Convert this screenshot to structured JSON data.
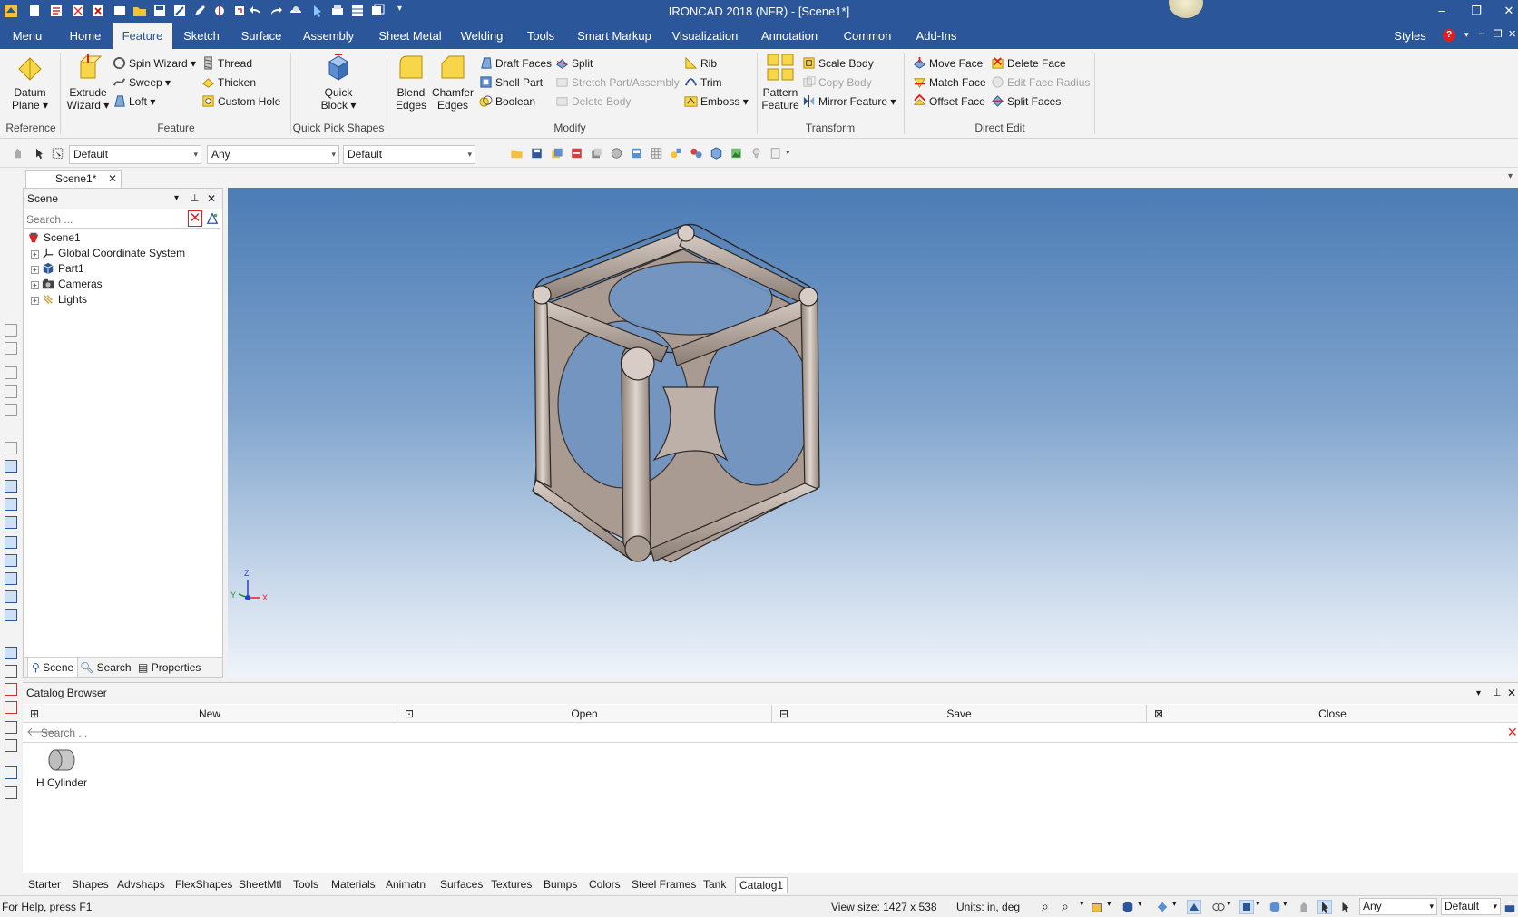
{
  "window": {
    "title": "IRONCAD 2018 (NFR) - [Scene1*]",
    "controls": {
      "minimize": "–",
      "restore": "❐",
      "close": "✕"
    }
  },
  "menu_tabs": [
    "Menu",
    "Home",
    "Feature",
    "Sketch",
    "Surface",
    "Assembly",
    "Sheet Metal",
    "Welding",
    "Tools",
    "Smart Markup",
    "Visualization",
    "Annotation",
    "Common",
    "Add-Ins"
  ],
  "menu_active": "Feature",
  "menu_right": {
    "styles": "Styles"
  },
  "ribbon": {
    "reference": {
      "datum_plane": "Datum",
      "datum_plane2": "Plane ▾",
      "group": "Reference"
    },
    "feature": {
      "extrude": "Extrude",
      "extrude2": "Wizard ▾",
      "spin_wizard": "Spin Wizard",
      "sweep": "Sweep",
      "loft": "Loft",
      "thread": "Thread",
      "thicken": "Thicken",
      "custom_hole": "Custom Hole",
      "group": "Feature"
    },
    "quick": {
      "quick_block": "Quick",
      "quick_block2": "Block ▾",
      "group": "Quick Pick Shapes"
    },
    "modify": {
      "blend": "Blend",
      "blend2": "Edges",
      "chamfer": "Chamfer",
      "chamfer2": "Edges",
      "draft_faces": "Draft Faces",
      "shell_part": "Shell Part",
      "boolean": "Boolean",
      "split": "Split",
      "stretch": "Stretch Part/Assembly",
      "delete_body": "Delete Body",
      "rib": "Rib",
      "trim": "Trim",
      "emboss": "Emboss",
      "group": "Modify"
    },
    "transform": {
      "pattern": "Pattern",
      "pattern2": "Feature",
      "scale_body": "Scale Body",
      "copy_body": "Copy Body",
      "mirror_feature": "Mirror Feature",
      "group": "Transform"
    },
    "direct_edit": {
      "move_face": "Move Face",
      "match_face": "Match Face",
      "offset_face": "Offset Face",
      "delete_face": "Delete Face",
      "edit_face_radius": "Edit Face Radius",
      "split_faces": "Split Faces",
      "group": "Direct Edit"
    }
  },
  "toolbar": {
    "combo1": "Default",
    "combo2": "Any",
    "combo3": "Default"
  },
  "doc_tab": {
    "label": "Scene1*"
  },
  "scene_panel": {
    "title": "Scene",
    "search_placeholder": "Search ...",
    "tree": [
      "Scene1",
      "Global Coordinate System",
      "Part1",
      "Cameras",
      "Lights"
    ],
    "tabs": [
      "Scene",
      "Search",
      "Properties"
    ]
  },
  "viewport": {
    "axis_labels": {
      "z": "Z",
      "y": "Y",
      "x": "X"
    }
  },
  "catalog": {
    "title": "Catalog Browser",
    "buttons": [
      "New",
      "Open",
      "Save",
      "Close"
    ],
    "search_placeholder": "Search ...",
    "items": [
      "H Cylinder"
    ],
    "tabs": [
      "Starter",
      "Shapes",
      "Advshaps",
      "FlexShapes",
      "SheetMtl",
      "Tools",
      "Materials",
      "Animatn",
      "Surfaces",
      "Textures",
      "Bumps",
      "Colors",
      "Steel Frames",
      "Tank",
      "Catalog1"
    ]
  },
  "status": {
    "help": "For Help, press F1",
    "view_size": "View size: 1427 x  538",
    "units": "Units: in, deg",
    "filter": "Any",
    "style": "Default"
  },
  "colors": {
    "accent": "#2b579a",
    "part": "#b9aca3"
  }
}
